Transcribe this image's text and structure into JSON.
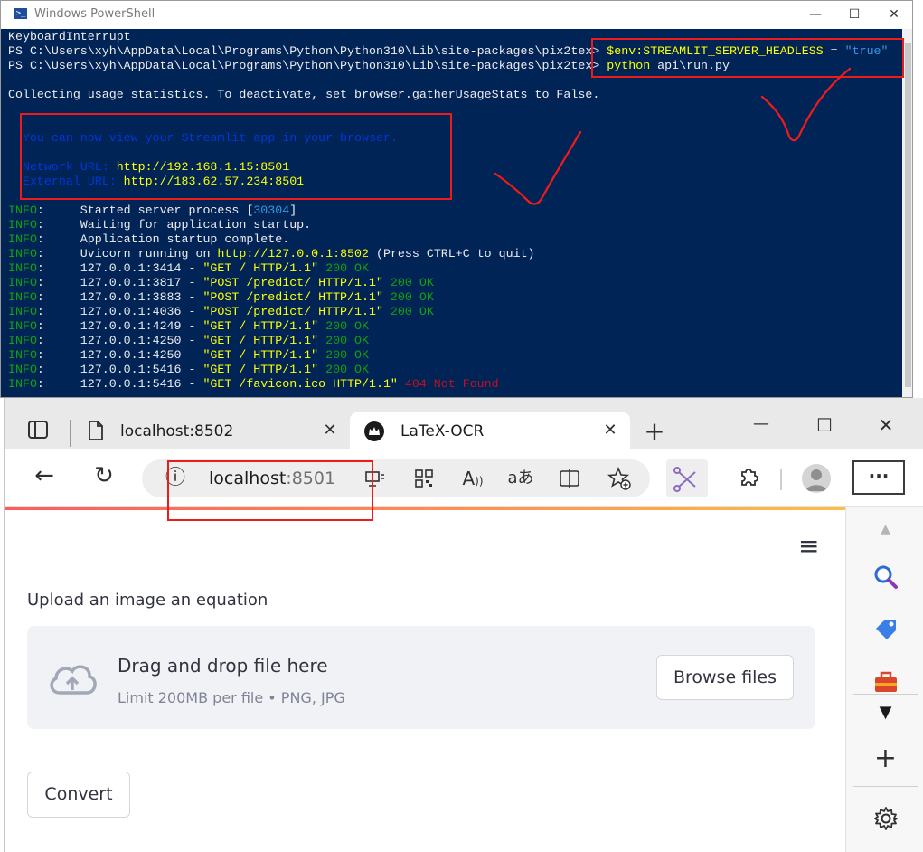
{
  "powershell": {
    "title": "Windows PowerShell",
    "controls": {
      "minimize": "—",
      "maximize": "☐",
      "close": "✕"
    },
    "lines": [
      {
        "parts": [
          {
            "t": "KeyboardInterrupt",
            "c": ""
          }
        ]
      },
      {
        "parts": [
          {
            "t": "PS C:\\Users\\xyh\\AppData\\Local\\Programs\\Python\\Python310\\Lib\\site-packages\\pix2tex> ",
            "c": ""
          },
          {
            "t": "$env:STREAMLIT_SERVER_HEADLESS",
            "c": "c-y"
          },
          {
            "t": " = ",
            "c": "c-gray"
          },
          {
            "t": "\"true\"",
            "c": "c-dim"
          }
        ]
      },
      {
        "parts": [
          {
            "t": "PS C:\\Users\\xyh\\AppData\\Local\\Programs\\Python\\Python310\\Lib\\site-packages\\pix2tex> ",
            "c": ""
          },
          {
            "t": "python",
            "c": "c-y"
          },
          {
            "t": " api\\run.py",
            "c": ""
          }
        ]
      },
      {
        "parts": [
          {
            "t": "",
            "c": ""
          }
        ]
      },
      {
        "parts": [
          {
            "t": "Collecting usage statistics. To deactivate, set browser.gatherUsageStats to False.",
            "c": ""
          }
        ]
      },
      {
        "parts": [
          {
            "t": "",
            "c": ""
          }
        ]
      },
      {
        "parts": [
          {
            "t": "",
            "c": ""
          }
        ]
      },
      {
        "parts": [
          {
            "t": "  You can now view your Streamlit app in your browser.",
            "c": "c-b"
          }
        ]
      },
      {
        "parts": [
          {
            "t": "",
            "c": ""
          }
        ]
      },
      {
        "parts": [
          {
            "t": "  Network URL: ",
            "c": "c-b"
          },
          {
            "t": "http://192.168.1.15:8501",
            "c": "c-y"
          }
        ]
      },
      {
        "parts": [
          {
            "t": "  External URL: ",
            "c": "c-b"
          },
          {
            "t": "http://183.62.57.234:8501",
            "c": "c-y"
          }
        ]
      },
      {
        "parts": [
          {
            "t": "",
            "c": ""
          }
        ]
      },
      {
        "parts": [
          {
            "t": "INFO",
            "c": "c-g"
          },
          {
            "t": ":     Started server process [",
            "c": ""
          },
          {
            "t": "30304",
            "c": "c-dim"
          },
          {
            "t": "]",
            "c": ""
          }
        ]
      },
      {
        "parts": [
          {
            "t": "INFO",
            "c": "c-g"
          },
          {
            "t": ":     Waiting for application startup.",
            "c": ""
          }
        ]
      },
      {
        "parts": [
          {
            "t": "INFO",
            "c": "c-g"
          },
          {
            "t": ":     Application startup complete.",
            "c": ""
          }
        ]
      },
      {
        "parts": [
          {
            "t": "INFO",
            "c": "c-g"
          },
          {
            "t": ":     Uvicorn running on ",
            "c": ""
          },
          {
            "t": "http://127.0.0.1:8502",
            "c": "c-y"
          },
          {
            "t": " (Press CTRL+C to quit)",
            "c": ""
          }
        ]
      },
      {
        "parts": [
          {
            "t": "INFO",
            "c": "c-g"
          },
          {
            "t": ":     127.0.0.1:3414 - ",
            "c": ""
          },
          {
            "t": "\"GET / HTTP/1.1\"",
            "c": "c-y"
          },
          {
            "t": " 200 OK",
            "c": "c-g"
          }
        ]
      },
      {
        "parts": [
          {
            "t": "INFO",
            "c": "c-g"
          },
          {
            "t": ":     127.0.0.1:3817 - ",
            "c": ""
          },
          {
            "t": "\"POST /predict/ HTTP/1.1\"",
            "c": "c-y"
          },
          {
            "t": " 200 OK",
            "c": "c-g"
          }
        ]
      },
      {
        "parts": [
          {
            "t": "INFO",
            "c": "c-g"
          },
          {
            "t": ":     127.0.0.1:3883 - ",
            "c": ""
          },
          {
            "t": "\"POST /predict/ HTTP/1.1\"",
            "c": "c-y"
          },
          {
            "t": " 200 OK",
            "c": "c-g"
          }
        ]
      },
      {
        "parts": [
          {
            "t": "INFO",
            "c": "c-g"
          },
          {
            "t": ":     127.0.0.1:4036 - ",
            "c": ""
          },
          {
            "t": "\"POST /predict/ HTTP/1.1\"",
            "c": "c-y"
          },
          {
            "t": " 200 OK",
            "c": "c-g"
          }
        ]
      },
      {
        "parts": [
          {
            "t": "INFO",
            "c": "c-g"
          },
          {
            "t": ":     127.0.0.1:4249 - ",
            "c": ""
          },
          {
            "t": "\"GET / HTTP/1.1\"",
            "c": "c-y"
          },
          {
            "t": " 200 OK",
            "c": "c-g"
          }
        ]
      },
      {
        "parts": [
          {
            "t": "INFO",
            "c": "c-g"
          },
          {
            "t": ":     127.0.0.1:4250 - ",
            "c": ""
          },
          {
            "t": "\"GET / HTTP/1.1\"",
            "c": "c-y"
          },
          {
            "t": " 200 OK",
            "c": "c-g"
          }
        ]
      },
      {
        "parts": [
          {
            "t": "INFO",
            "c": "c-g"
          },
          {
            "t": ":     127.0.0.1:4250 - ",
            "c": ""
          },
          {
            "t": "\"GET / HTTP/1.1\"",
            "c": "c-y"
          },
          {
            "t": " 200 OK",
            "c": "c-g"
          }
        ]
      },
      {
        "parts": [
          {
            "t": "INFO",
            "c": "c-g"
          },
          {
            "t": ":     127.0.0.1:5416 - ",
            "c": ""
          },
          {
            "t": "\"GET / HTTP/1.1\"",
            "c": "c-y"
          },
          {
            "t": " 200 OK",
            "c": "c-g"
          }
        ]
      },
      {
        "parts": [
          {
            "t": "INFO",
            "c": "c-g"
          },
          {
            "t": ":     127.0.0.1:5416 - ",
            "c": ""
          },
          {
            "t": "\"GET /favicon.ico HTTP/1.1\"",
            "c": "c-y"
          },
          {
            "t": " 404 Not Found",
            "c": "c-r"
          }
        ]
      }
    ]
  },
  "browser": {
    "tabs": [
      {
        "label": "localhost:8502",
        "icon": "page-icon",
        "close": "✕"
      },
      {
        "label": "LaTeX-OCR",
        "icon": "streamlit-crown-icon",
        "close": "✕"
      }
    ],
    "new_tab": "+",
    "window_controls": {
      "minimize": "—",
      "maximize": "☐",
      "close": "✕"
    },
    "address": {
      "host": "localhost",
      "port": ":8501"
    },
    "toolbar_icons": {
      "back": "←",
      "refresh": "↻",
      "info": "ⓘ",
      "more": "···"
    }
  },
  "app": {
    "menu_icon": "≡",
    "upload_label": "Upload an image an equation",
    "dropzone": {
      "title": "Drag and drop file here",
      "limit": "Limit 200MB per file • PNG, JPG",
      "browse_button": "Browse files"
    },
    "convert_button": "Convert"
  },
  "colors": {
    "console_bg": "#012456",
    "annotation_red": "#ee1b1b",
    "dropzone_bg": "#f0f2f6"
  }
}
